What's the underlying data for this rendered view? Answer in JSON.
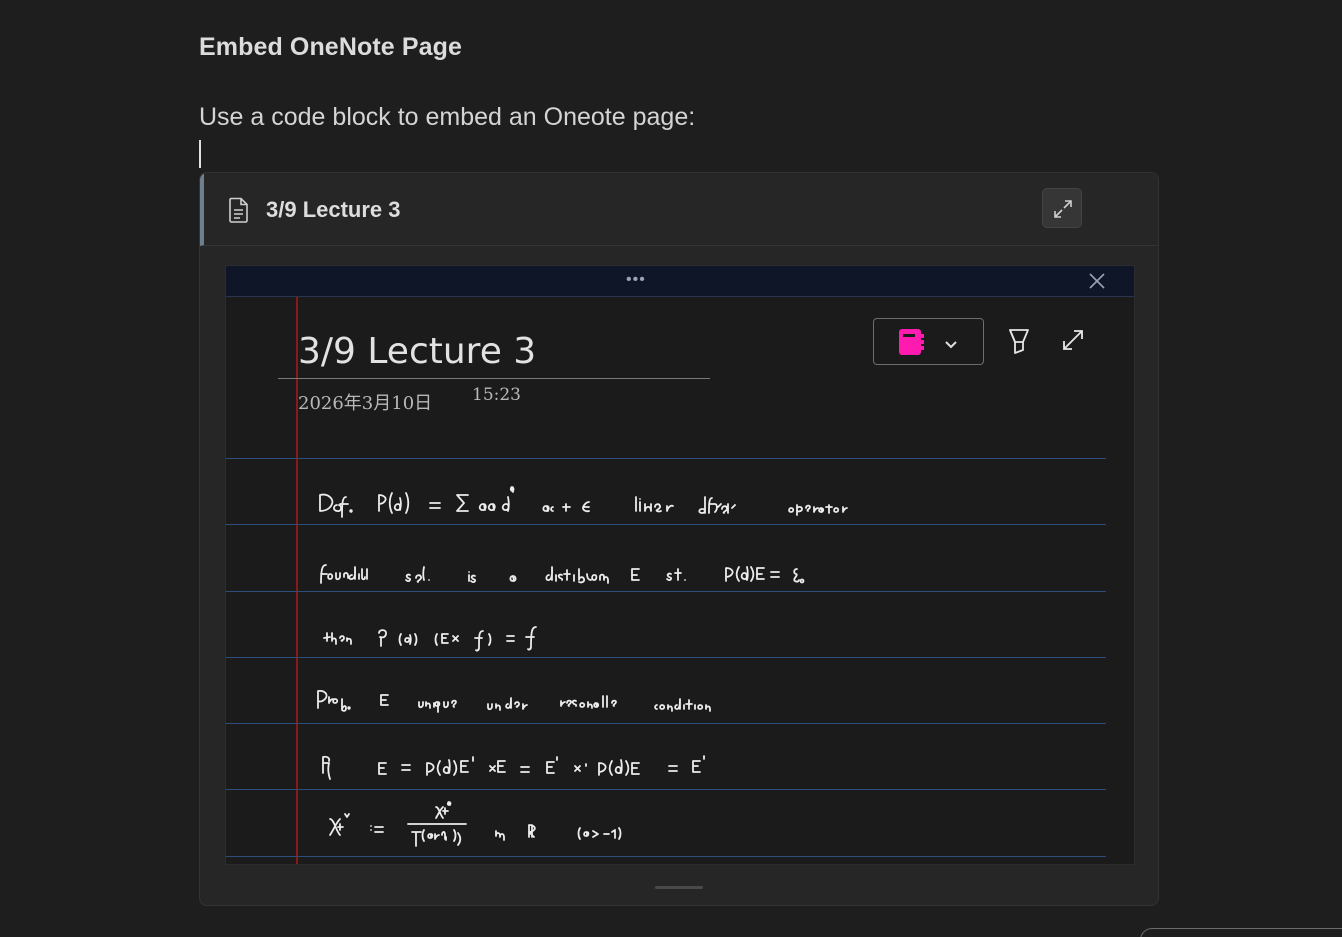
{
  "document": {
    "heading": "Embed OneNote Page",
    "intro": "Use a code block to embed an Oneote page:"
  },
  "embed": {
    "title": "3/9 Lecture 3",
    "icon": "document-icon",
    "expand_icon": "expand-icon"
  },
  "viewer": {
    "drag_dots": "•••",
    "close_icon": "close-icon",
    "page": {
      "title": "3/9 Lecture 3",
      "date": "2026年3月10日",
      "time": "15:23"
    },
    "toolbar": {
      "notebook_icon": "notebook-icon",
      "notebook_color": "#ff1ab0",
      "dropdown_icon": "chevron-down-icon",
      "pen_icon": "highlighter-icon",
      "fullscreen_icon": "fullscreen-icon"
    },
    "handwritten_lines": [
      "Def. P(∂) = Σ a_α ∂^α   a_α ∈ ℂ   linear differential operator",
      "Fundamental sol. is a distribution E s.t. P(∂) E = δ₀",
      "then P(∂)(E * f) = f",
      "Prop. E unique under reasonable condition",
      "Pf  E = P(∂)E' * E = E' * P(∂)E = E'",
      "χ₊^a := x₊^a / Γ(a+1)  on ℝ  (a > -1)"
    ]
  },
  "colors": {
    "background": "#1e1e1e",
    "accent_bar": "#6d7f8f",
    "margin_line": "#8a1a1a",
    "rule_line": "#2b4f7a"
  }
}
